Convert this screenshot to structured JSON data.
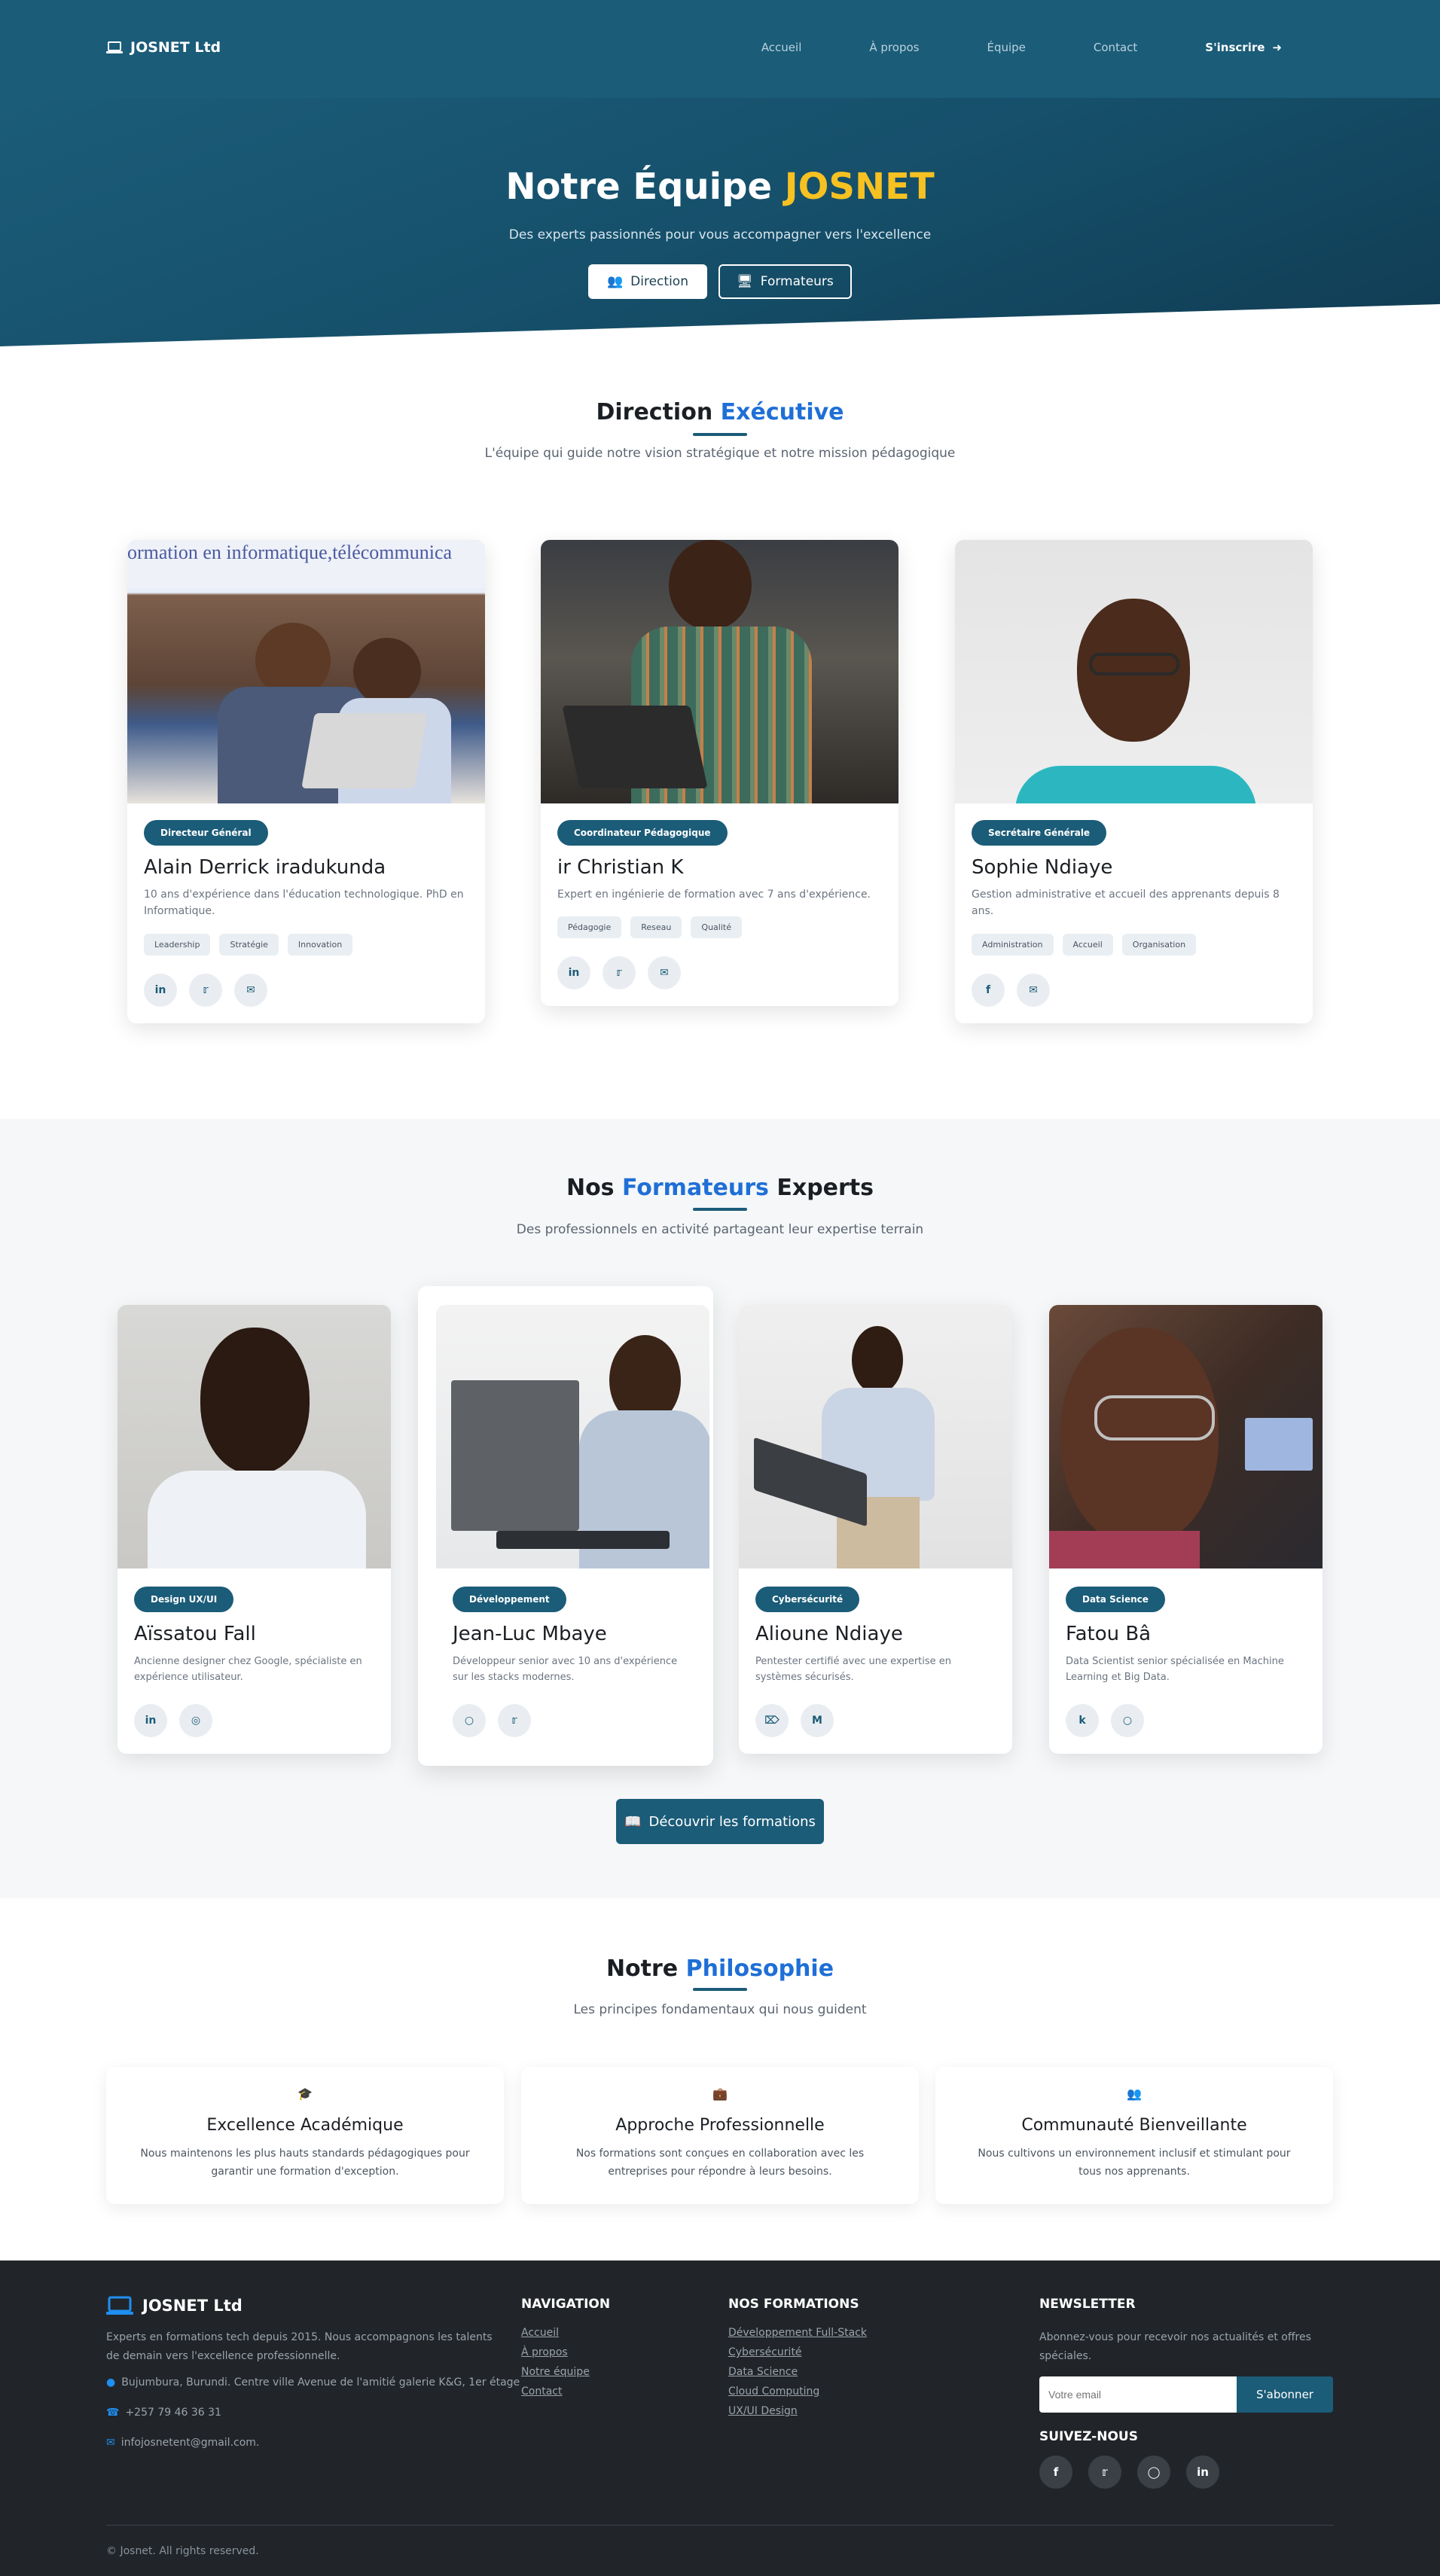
{
  "nav": {
    "brand": "JOSNET Ltd",
    "links": [
      "Accueil",
      "À propos",
      "Équipe",
      "Contact"
    ],
    "cta": "S'inscrire"
  },
  "hero": {
    "title_main": "Notre Équipe",
    "title_accent": "JOSNET",
    "subtitle": "Des experts passionnés pour vous accompagner vers l'excellence",
    "btn_direction": "Direction",
    "btn_formateurs": "Formateurs"
  },
  "direction": {
    "title_a": "Direction",
    "title_b": "Exécutive",
    "subtitle": "L'équipe qui guide notre vision stratégique et notre mission pédagogique",
    "members": [
      {
        "role": "Directeur Général",
        "name": "Alain Derrick iradukunda",
        "desc": "10 ans d'expérience dans l'éducation technologique. PhD en Informatique.",
        "tags": [
          "Leadership",
          "Stratégie",
          "Innovation"
        ],
        "socials": [
          "linkedin-icon",
          "twitter-icon",
          "envelope-icon"
        ],
        "photo_caption": "ormation en informatique,télécommunica"
      },
      {
        "role": "Coordinateur Pédagogique",
        "name": "ir Christian K",
        "desc": "Expert en ingénierie de formation avec 7 ans d'expérience.",
        "tags": [
          "Pédagogie",
          "Reseau",
          "Qualité"
        ],
        "socials": [
          "linkedin-icon",
          "twitter-icon",
          "envelope-icon"
        ]
      },
      {
        "role": "Secrétaire Générale",
        "name": "Sophie Ndiaye",
        "desc": "Gestion administrative et accueil des apprenants depuis 8 ans.",
        "tags": [
          "Administration",
          "Accueil",
          "Organisation"
        ],
        "socials": [
          "facebook-icon",
          "envelope-icon"
        ]
      }
    ]
  },
  "formateurs": {
    "title_a": "Nos",
    "title_b": "Formateurs",
    "title_c": "Experts",
    "subtitle": "Des professionnels en activité partageant leur expertise terrain",
    "members": [
      {
        "role": "Design UX/UI",
        "name": "Aïssatou Fall",
        "desc": "Ancienne designer chez Google, spécialiste en expérience utilisateur.",
        "socials": [
          "linkedin-icon",
          "dribbble-icon"
        ]
      },
      {
        "role": "Développement",
        "name": "Jean-Luc Mbaye",
        "desc": "Développeur senior avec 10 ans d'expérience sur les stacks modernes.",
        "socials": [
          "github-icon",
          "twitter-icon"
        ]
      },
      {
        "role": "Cybersécurité",
        "name": "Alioune Ndiaye",
        "desc": "Pentester certifié avec une expertise en systèmes sécurisés.",
        "socials": [
          "hackerrank-icon",
          "medium-icon"
        ]
      },
      {
        "role": "Data Science",
        "name": "Fatou Bâ",
        "desc": "Data Scientist senior spécialisée en Machine Learning et Big Data.",
        "socials": [
          "kaggle-icon",
          "github-icon"
        ]
      }
    ],
    "cta": "Découvrir les formations"
  },
  "philosophie": {
    "title_a": "Notre",
    "title_b": "Philosophie",
    "subtitle": "Les principes fondamentaux qui nous guident",
    "items": [
      {
        "icon": "graduation-cap-icon",
        "title": "Excellence Académique",
        "desc": "Nous maintenons les plus hauts standards pédagogiques pour garantir une formation d'exception."
      },
      {
        "icon": "briefcase-icon",
        "title": "Approche Professionnelle",
        "desc": "Nos formations sont conçues en collaboration avec les entreprises pour répondre à leurs besoins."
      },
      {
        "icon": "users-icon",
        "title": "Communauté Bienveillante",
        "desc": "Nous cultivons un environnement inclusif et stimulant pour tous nos apprenants."
      }
    ]
  },
  "footer": {
    "brand": "JOSNET Ltd",
    "about": "Experts en formations tech depuis 2015. Nous accompagnons les talents de demain vers l'excellence professionnelle.",
    "address": "Bujumbura, Burundi. Centre ville Avenue de l'amitié galerie K&G, 1er étage",
    "phone": "+257 79 46 36 31",
    "email": "infojosnetent@gmail.com.",
    "nav_title": "NAVIGATION",
    "nav_links": [
      "Accueil",
      "À propos",
      "Notre équipe",
      "Contact"
    ],
    "formations_title": "NOS FORMATIONS",
    "formations_links": [
      "Développement Full-Stack",
      "Cybersécurité",
      "Data Science",
      "Cloud Computing",
      "UX/UI Design"
    ],
    "newsletter_title": "NEWSLETTER",
    "newsletter_text": "Abonnez-vous pour recevoir nos actualités et offres spéciales.",
    "newsletter_placeholder": "Votre email",
    "newsletter_btn": "S'abonner",
    "follow_title": "SUIVEZ-NOUS",
    "follow_icons": [
      "facebook-icon",
      "twitter-icon",
      "instagram-icon",
      "linkedin-icon"
    ],
    "copyright": "© Josnet. All rights reserved."
  },
  "colors": {
    "primary": "#1b5c78",
    "accent_yellow": "#f6c121",
    "accent_blue": "#1f6fd6",
    "footer_bg": "#212529"
  }
}
